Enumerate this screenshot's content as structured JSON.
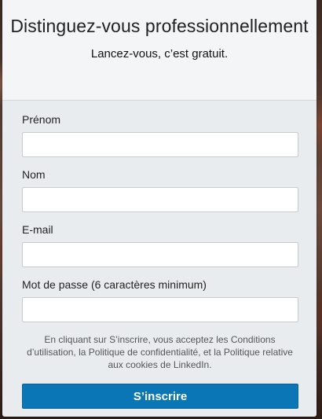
{
  "header": {
    "headline": "Distinguez-vous professionnellement",
    "subline": "Lancez-vous, c’est gratuit."
  },
  "form": {
    "first_name_label": "Prénom",
    "last_name_label": "Nom",
    "email_label": "E-mail",
    "password_label": "Mot de passe (6 caractères minimum)",
    "first_name_value": "",
    "last_name_value": "",
    "email_value": "",
    "password_value": ""
  },
  "terms_text": "En cliquant sur S’inscrire, vous acceptez les Conditions d’utilisation, la Politique de confidentialité, et la Politique relative aux cookies de LinkedIn.",
  "submit_label": "S’inscrire",
  "colors": {
    "primary": "#0a76b6",
    "card_background": "#e9ecee",
    "header_background": "#f4f5f6"
  }
}
